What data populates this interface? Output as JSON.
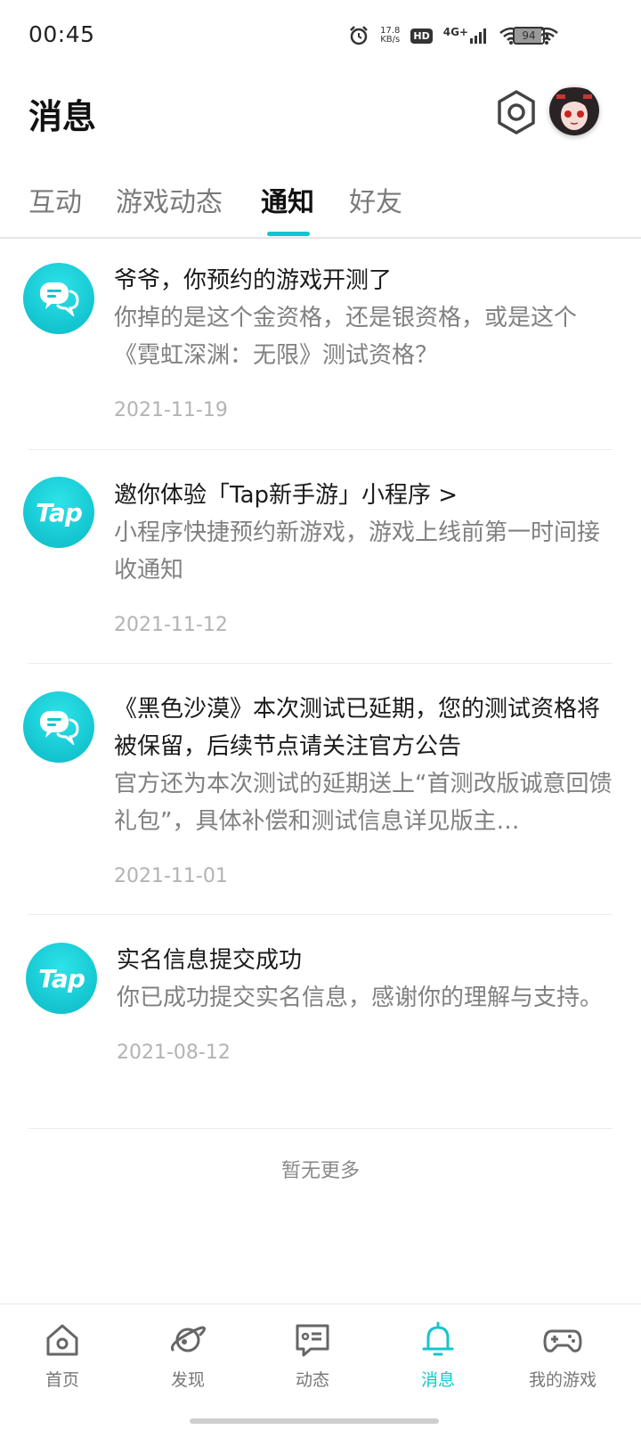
{
  "status_bar": {
    "time": "00:45",
    "net_speed_value": "17.8",
    "net_speed_unit": "KB/s",
    "hd_label": "HD",
    "network_label": "4G+",
    "battery": "94"
  },
  "header": {
    "title": "消息"
  },
  "tabs": [
    {
      "label": "互动"
    },
    {
      "label": "游戏动态"
    },
    {
      "label": "通知"
    },
    {
      "label": "好友"
    }
  ],
  "notifications": [
    {
      "icon": "chat-bubble-icon",
      "title": "爷爷，你预约的游戏开测了",
      "desc": "你掉的是这个金资格，还是银资格，或是这个《霓虹深渊：无限》测试资格？",
      "date": "2021-11-19"
    },
    {
      "icon": "tap-logo-icon",
      "icon_text": "Tap",
      "title": "邀你体验「Tap新手游」小程序 >",
      "desc": "小程序快捷预约新游戏，游戏上线前第一时间接收通知",
      "date": "2021-11-12"
    },
    {
      "icon": "chat-bubble-icon",
      "title": "《黑色沙漠》本次测试已延期，您的测试资格将被保留，后续节点请关注官方公告",
      "desc": "官方还为本次测试的延期送上“首测改版诚意回馈礼包”，具体补偿和测试信息详见版主…",
      "date": "2021-11-01"
    },
    {
      "icon": "tap-logo-icon",
      "icon_text": "Tap",
      "title": "实名信息提交成功",
      "desc": "你已成功提交实名信息，感谢你的理解与支持。",
      "date": "2021-08-12"
    }
  ],
  "no_more": "暂无更多",
  "bottom_nav": [
    {
      "label": "首页",
      "icon": "home-icon"
    },
    {
      "label": "发现",
      "icon": "planet-icon"
    },
    {
      "label": "动态",
      "icon": "feed-icon"
    },
    {
      "label": "消息",
      "icon": "bell-icon"
    },
    {
      "label": "我的游戏",
      "icon": "gamepad-icon"
    }
  ],
  "colors": {
    "accent": "#15c5ce",
    "muted_text": "#808080",
    "date_text": "#b3b3b3"
  }
}
